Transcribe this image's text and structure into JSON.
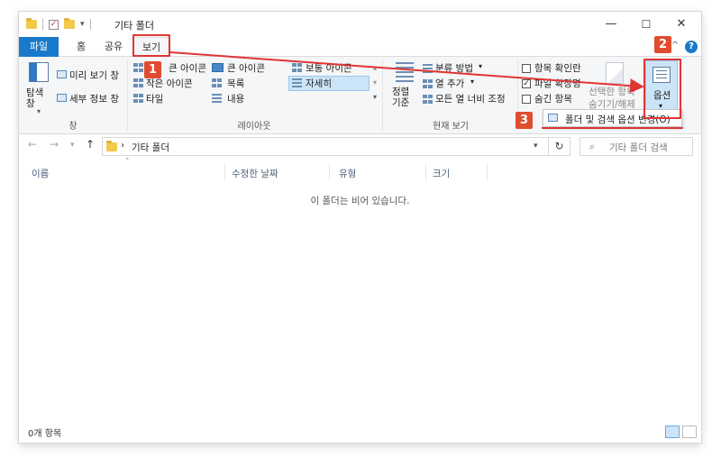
{
  "window": {
    "title": "기타 폴더",
    "minimize_glyph": "—",
    "maximize_glyph": "☐",
    "close_glyph": "✕"
  },
  "ribbon_tabs": [
    "파일",
    "홈",
    "공유",
    "보기"
  ],
  "help_glyph": "?",
  "ribbon": {
    "pane": {
      "nav_pane_label": "탐색\n창",
      "preview_pane": "미리 보기 창",
      "details_pane": "세부 정보 창",
      "group_label": "창"
    },
    "layout": {
      "items": [
        "큰 아이콘",
        "큰 아이콘",
        "보통 아이콘",
        "작은 아이콘",
        "목록",
        "자세히",
        "타일",
        "내용"
      ],
      "selected": "자세히",
      "group_label": "레이아웃"
    },
    "current_view": {
      "sort_by": "정렬\n기준",
      "group_by": "분류 방법",
      "add_columns": "열 추가",
      "size_all_columns": "모든 열 너비 조정",
      "group_label": "현재 보기"
    },
    "show_hide": {
      "item_checkboxes": "항목 확인란",
      "file_extensions": "파일 확장명",
      "hidden_items": "숨긴 항목",
      "file_extensions_checked": true,
      "item_checkboxes_checked": false,
      "hidden_items_checked": false,
      "hide_selected": "선택한 항목\n숨기기/해제"
    },
    "options": {
      "label": "옵션",
      "dropdown_item": "폴더 및 검색 옵션 변경(O)"
    }
  },
  "annotations": {
    "badge1": "1",
    "badge2": "2",
    "badge3": "3",
    "color": "#e03535"
  },
  "address": {
    "path": "기타 폴더",
    "search_placeholder": "기타 폴더 검색"
  },
  "columns": [
    "이름",
    "수정한 날짜",
    "유형",
    "크기"
  ],
  "empty_message": "이 폴더는 비어 있습니다.",
  "status": {
    "item_count": "0개 항목"
  },
  "colors": {
    "file_tab": "#1979ca",
    "selection": "#cce4f7",
    "highlight_red": "#e03535"
  }
}
